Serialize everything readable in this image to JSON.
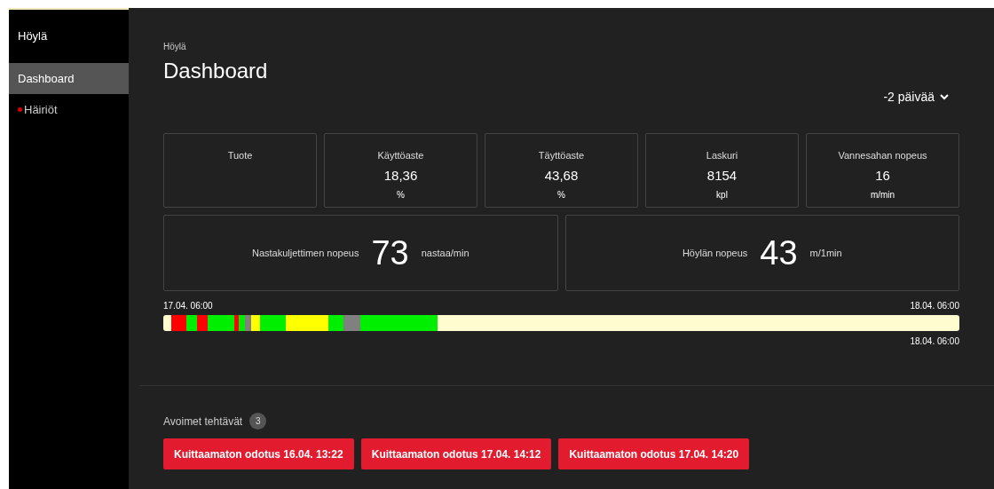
{
  "sidebar": {
    "title": "Höylä",
    "items": [
      {
        "label": "Dashboard",
        "selected": true,
        "alert": false
      },
      {
        "label": "Häiriöt",
        "selected": false,
        "alert": true
      }
    ]
  },
  "header": {
    "breadcrumb": "Höylä",
    "title": "Dashboard",
    "range": "-2 päivää"
  },
  "stats": [
    {
      "label": "Tuote"
    },
    {
      "label": "Käyttöaste",
      "value": "18,36",
      "unit": "%"
    },
    {
      "label": "Täyttöaste",
      "value": "43,68",
      "unit": "%"
    },
    {
      "label": "Laskuri",
      "value": "8154",
      "unit": "kpl"
    },
    {
      "label": "Vannesahan nopeus",
      "value": "16",
      "unit": "m/min"
    }
  ],
  "speeds": [
    {
      "label": "Nastakuljettimen nopeus",
      "value": "73",
      "unit": "nastaa/min"
    },
    {
      "label": "Höylän nopeus",
      "value": "43",
      "unit": "m/1min"
    }
  ],
  "timeline": {
    "start": "17.04. 06:00",
    "end": "18.04. 06:00",
    "end_below": "18.04. 06:00",
    "segments": [
      {
        "color": "#fffdd0"
      },
      {
        "color": "#ff0000"
      },
      {
        "color": "#00ee00"
      },
      {
        "color": "#ff0000"
      },
      {
        "color": "#00ee00"
      },
      {
        "color": "#ff0000"
      },
      {
        "color": "#00ee00"
      },
      {
        "color": "#808080"
      },
      {
        "color": "#ffff00"
      },
      {
        "color": "#00ee00"
      },
      {
        "color": "#ffff00"
      },
      {
        "color": "#00ee00"
      },
      {
        "color": "#808080"
      },
      {
        "color": "#00ee00"
      },
      {
        "color": "#fffdd0"
      }
    ]
  },
  "tasks": {
    "title": "Avoimet tehtävät",
    "count": "3",
    "items": [
      "Kuittaamaton odotus 16.04. 13:22",
      "Kuittaamaton odotus 17.04. 14:12",
      "Kuittaamaton odotus 17.04. 14:20"
    ]
  }
}
